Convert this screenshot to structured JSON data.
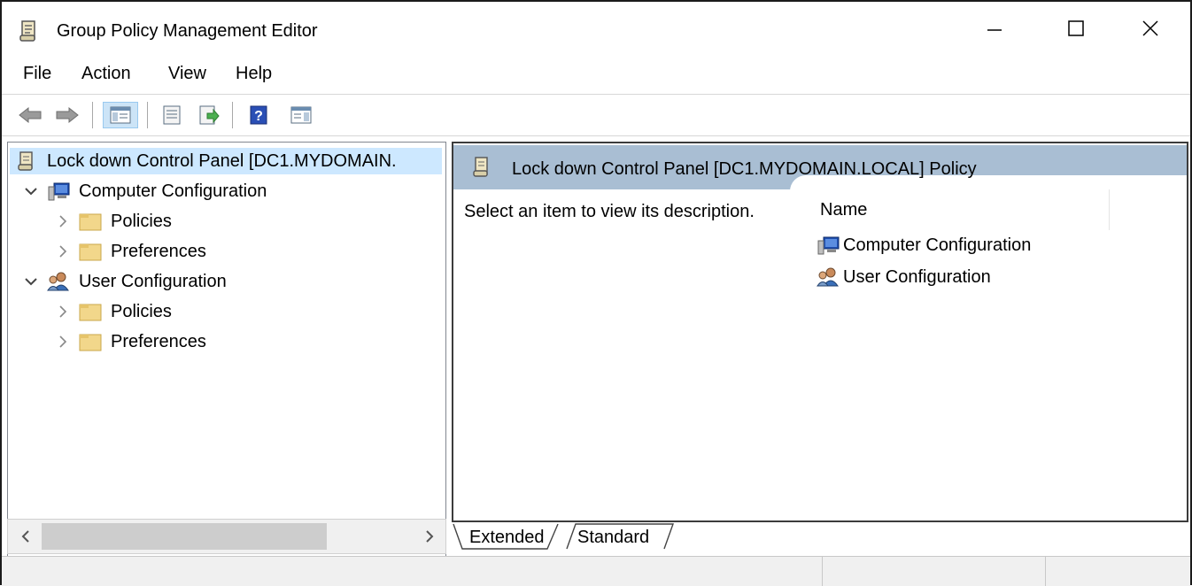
{
  "window": {
    "title": "Group Policy Management Editor",
    "icon": "policy-scroll-icon"
  },
  "menu": {
    "items": [
      "File",
      "Action",
      "View",
      "Help"
    ]
  },
  "toolbar": {
    "buttons": [
      "back-icon",
      "forward-icon",
      "show-hide-console-tree-icon",
      "properties-icon",
      "export-list-icon",
      "help-icon",
      "show-hide-action-pane-icon"
    ]
  },
  "tree": {
    "root": {
      "label": "Lock down Control Panel [DC1.MYDOMAIN."
    },
    "computer": {
      "label": "Computer Configuration",
      "children": [
        "Policies",
        "Preferences"
      ]
    },
    "user": {
      "label": "User Configuration",
      "children": [
        "Policies",
        "Preferences"
      ]
    }
  },
  "details": {
    "header_title": "Lock down Control Panel [DC1.MYDOMAIN.LOCAL] Policy",
    "description": "Select an item to view its description.",
    "column_name": "Name",
    "items": [
      "Computer Configuration",
      "User Configuration"
    ]
  },
  "tabs": [
    "Extended",
    "Standard"
  ],
  "colors": {
    "selection": "#cde8ff",
    "header_band": "#a9bed3",
    "folder": "#f2d78b"
  }
}
